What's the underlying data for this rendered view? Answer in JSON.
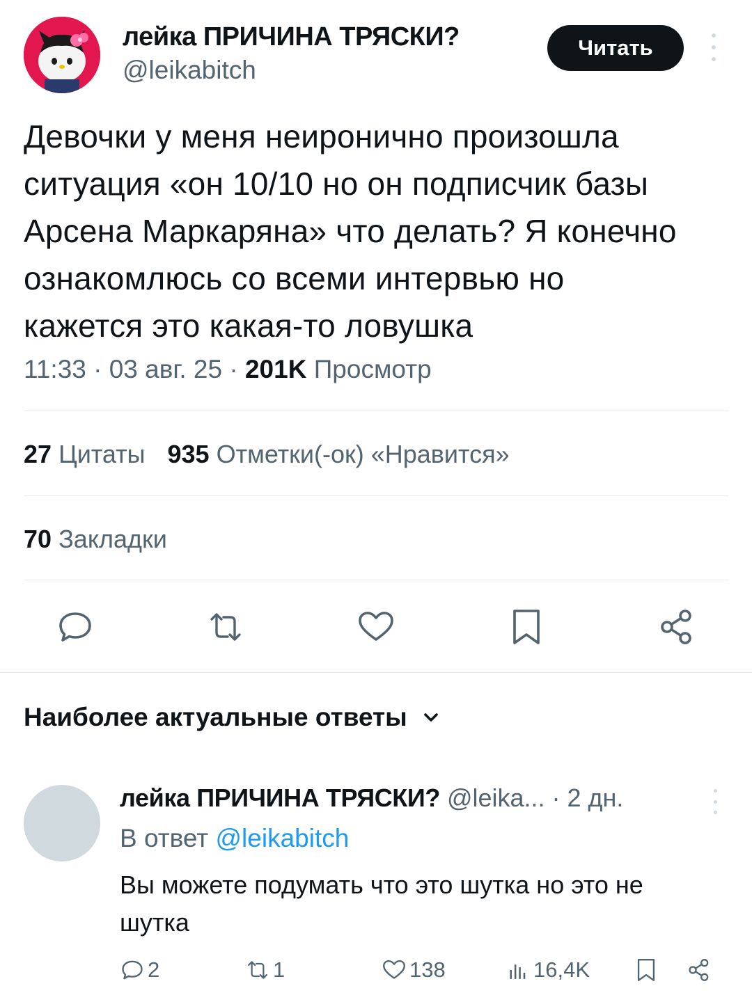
{
  "tweet": {
    "author_name": "лейка ПРИЧИНА ТРЯСКИ?",
    "author_handle": "@leikabitch",
    "avatar_icon": "avatar-image",
    "follow_label": "Читать",
    "text_lines": [
      "Девочки у меня неиронично произошла",
      "ситуация «он 10/10 но он подписчик базы",
      "Арсена Маркаряна» что делать? Я конечно",
      "ознакомлюсь со всеми интервью но",
      "кажется это какая-то ловушка"
    ],
    "time": "11:33 · 03 авг. 25 · ",
    "views_count": "201K",
    "views_label": " Просмотр"
  },
  "stats": {
    "quotes_count": "27",
    "quotes_label": "Цитаты",
    "likes_count": "935",
    "likes_label": "Отметки(-ок) «Нравится»",
    "bookmarks_count": "70",
    "bookmarks_label": "Закладки"
  },
  "actions": {
    "icons": [
      "reply-icon",
      "retweet-icon",
      "like-icon",
      "bookmark-icon",
      "share-icon"
    ]
  },
  "replies_section": {
    "heading": "Наиболее актуальные ответы"
  },
  "reply": {
    "author_name": "лейка ПРИЧИНА ТРЯСКИ?",
    "author_handle": " @leika...",
    "time": " · 2 дн.",
    "reply_to_prefix": "В ответ ",
    "reply_to_handle": "@leikabitch",
    "text_lines": [
      "Вы можете подумать что это шутка но это не",
      "шутка"
    ],
    "replies_count": "2",
    "retweets_count": "1",
    "likes_count": "138",
    "views_count": "16,4K"
  },
  "colors": {
    "text": "#0f1419",
    "secondary": "#536471",
    "link": "#1d9bf0",
    "divider": "#e6ecf0",
    "button_bg": "#0f1419",
    "avatar_bg": "#e3174f",
    "placeholder_avatar": "#cfd9de"
  }
}
